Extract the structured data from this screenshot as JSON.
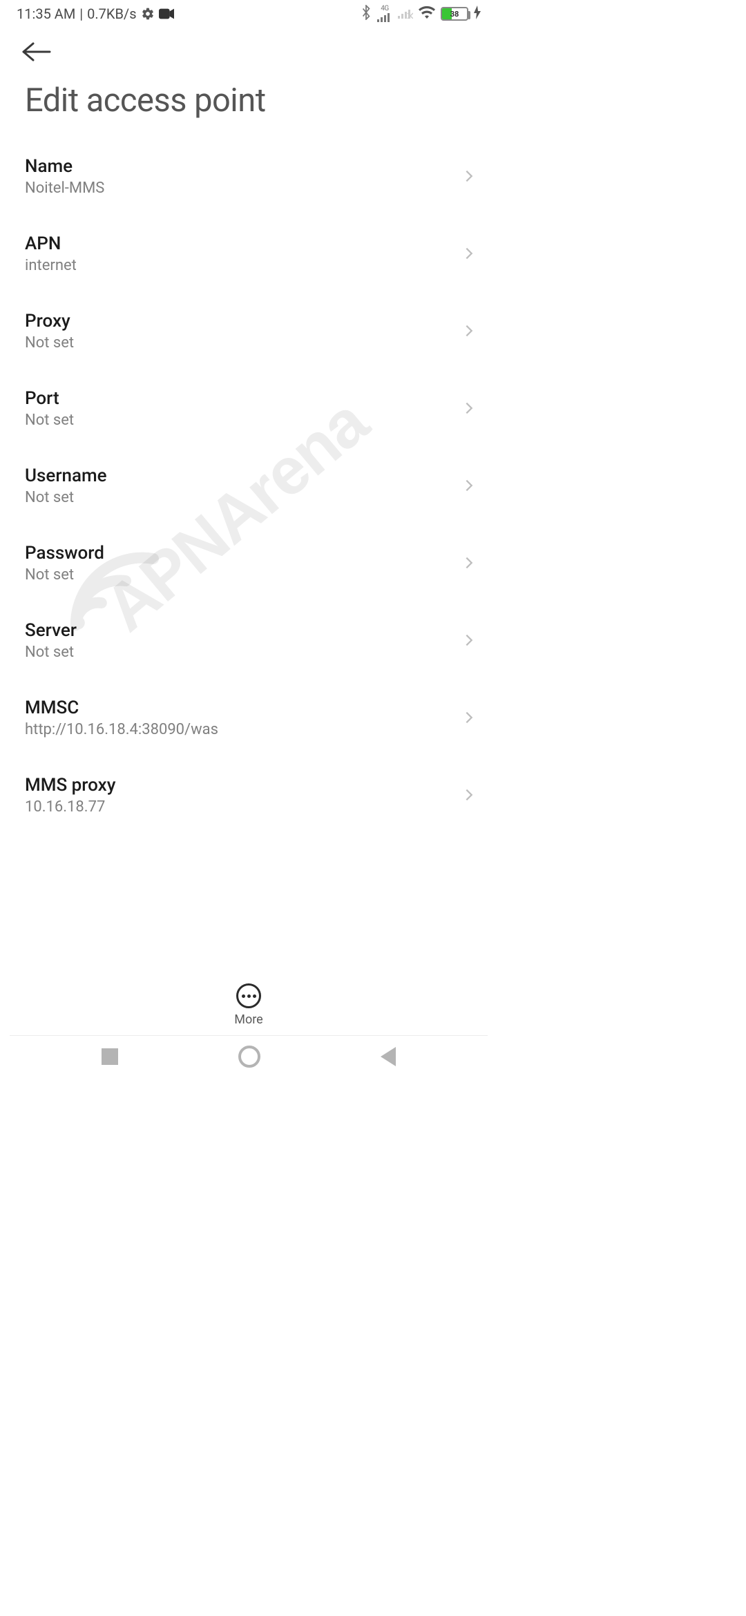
{
  "status": {
    "time": "11:35 AM",
    "sep": " | ",
    "speed": "0.7KB/s",
    "battery_pct": "38",
    "network_tag": "4G"
  },
  "header": {
    "title": "Edit access point"
  },
  "fields": [
    {
      "label": "Name",
      "value": "Noitel-MMS"
    },
    {
      "label": "APN",
      "value": "internet"
    },
    {
      "label": "Proxy",
      "value": "Not set"
    },
    {
      "label": "Port",
      "value": "Not set"
    },
    {
      "label": "Username",
      "value": "Not set"
    },
    {
      "label": "Password",
      "value": "Not set"
    },
    {
      "label": "Server",
      "value": "Not set"
    },
    {
      "label": "MMSC",
      "value": "http://10.16.18.4:38090/was"
    },
    {
      "label": "MMS proxy",
      "value": "10.16.18.77"
    }
  ],
  "bottom": {
    "more_label": "More"
  },
  "watermark": "APNArena"
}
